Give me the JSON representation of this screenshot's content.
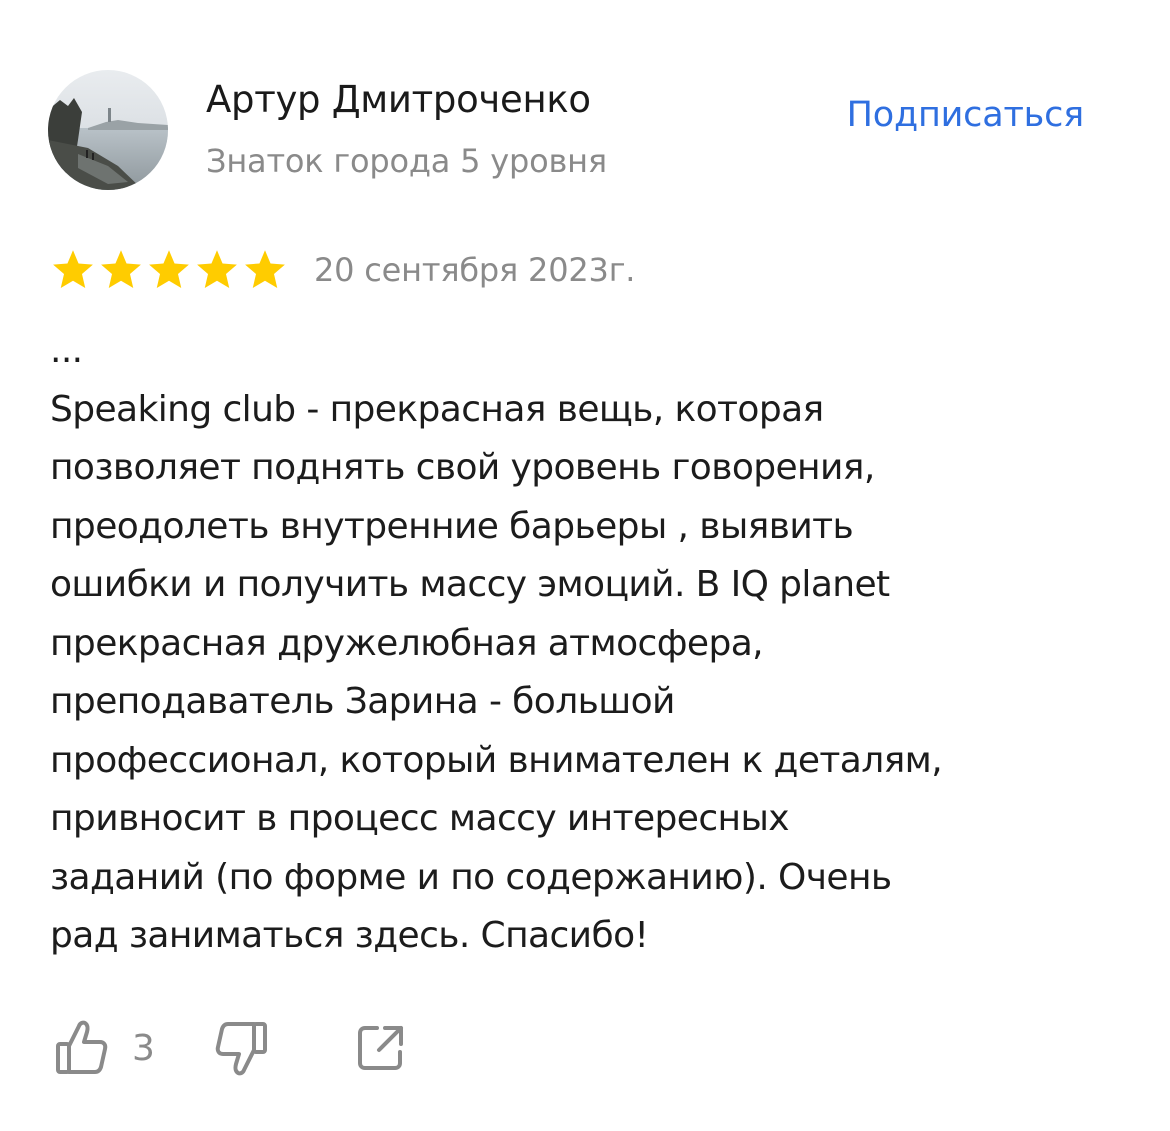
{
  "author": {
    "name": "Артур Дмитроченко",
    "level": "Знаток города 5 уровня",
    "avatar_icon": "user-photo-avatar"
  },
  "subscribe_label": "Подписаться",
  "rating": {
    "stars": 5,
    "max_stars": 5,
    "star_color": "#ffcc00"
  },
  "date": "20 сентября 2023г.",
  "text": "...\nSpeaking club - прекрасная вещь, которая\nпозволяет поднять свой уровень говорения,\nпреодолеть внутренние барьеры , выявить\nошибки и получить массу эмоций. В IQ planet\nпрекрасная дружелюбная атмосфера,\nпреподаватель Зарина - большой\nпрофессионал, который внимателен к деталям,\nпривносит в процесс массу интересных\nзаданий (по форме и по содержанию). Очень\nрад заниматься здесь. Спасибо!",
  "actions": {
    "likes": "3",
    "like_icon": "thumbs-up-icon",
    "dislike_icon": "thumbs-down-icon",
    "share_icon": "share-icon"
  },
  "colors": {
    "accent": "#2f6fe0",
    "secondary_text": "#8a8a8a",
    "icon": "#8a8a8a"
  }
}
